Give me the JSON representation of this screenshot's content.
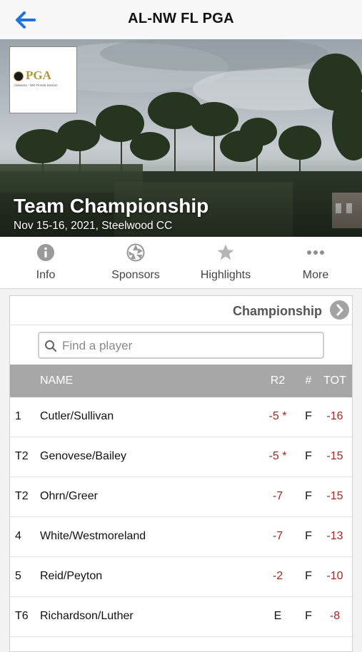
{
  "header": {
    "title": "AL-NW FL PGA",
    "back_icon": "back-arrow-icon",
    "accent": "#1a73e8"
  },
  "event": {
    "logo_text": "PGA",
    "logo_subtext": "Alabama - NW Florida Section",
    "title": "Team Championship",
    "subtitle": "Nov 15-16, 2021, Steelwood CC"
  },
  "tabs": [
    {
      "label": "Info",
      "icon": "info-icon"
    },
    {
      "label": "Sponsors",
      "icon": "aperture-icon"
    },
    {
      "label": "Highlights",
      "icon": "star-icon"
    },
    {
      "label": "More",
      "icon": "more-dots-icon"
    }
  ],
  "leaderboard": {
    "division": "Championship",
    "search_placeholder": "Find a player",
    "columns": {
      "name": "NAME",
      "round": "R2",
      "hole": "#",
      "total": "TOT"
    },
    "rows": [
      {
        "pos": "1",
        "name": "Cutler/Sullivan",
        "r2": "-5 *",
        "hole": "F",
        "tot": "-16"
      },
      {
        "pos": "T2",
        "name": "Genovese/Bailey",
        "r2": "-5 *",
        "hole": "F",
        "tot": "-15"
      },
      {
        "pos": "T2",
        "name": "Ohrn/Greer",
        "r2": "-7",
        "hole": "F",
        "tot": "-15"
      },
      {
        "pos": "4",
        "name": "White/Westmoreland",
        "r2": "-7",
        "hole": "F",
        "tot": "-13"
      },
      {
        "pos": "5",
        "name": "Reid/Peyton",
        "r2": "-2",
        "hole": "F",
        "tot": "-10"
      },
      {
        "pos": "T6",
        "name": "Richardson/Luther",
        "r2": "E",
        "hole": "F",
        "tot": "-8"
      }
    ],
    "under_par_color": "#c41a1a"
  }
}
